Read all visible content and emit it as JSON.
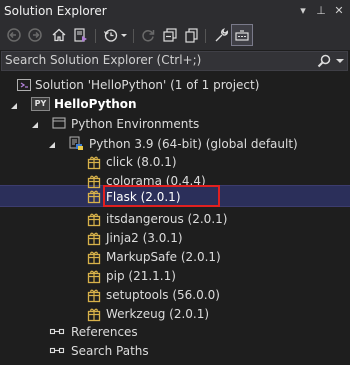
{
  "window": {
    "title": "Solution Explorer",
    "controls": {
      "dropdown": "▾",
      "pin": "⊥",
      "close": "✕"
    }
  },
  "toolbar": {
    "buttons": [
      "back-icon",
      "forward-icon",
      "home-icon",
      "sync-with-active-document-icon",
      "history-icon",
      "refresh-icon",
      "collapse-all-icon",
      "show-all-files-icon",
      "properties-icon",
      "preview-selected-items-icon"
    ]
  },
  "search": {
    "placeholder": "Search Solution Explorer (Ctrl+;)"
  },
  "tree": {
    "solution": "Solution 'HelloPython' (1 of 1 project)",
    "project": "HelloPython",
    "project_badge": "PY",
    "environments": "Python Environments",
    "interpreter": "Python 3.9 (64-bit) (global default)",
    "packages": [
      "click (8.0.1)",
      "colorama (0.4.4)",
      "Flask (2.0.1)",
      "itsdangerous (2.0.1)",
      "Jinja2 (3.0.1)",
      "MarkupSafe (2.0.1)",
      "pip (21.1.1)",
      "setuptools (56.0.0)",
      "Werkzeug (2.0.1)"
    ],
    "selected_package": "Flask (2.0.1)",
    "references": "References",
    "search_paths": "Search Paths"
  },
  "colors": {
    "background": "#1e1e1e",
    "selection": "#2b2f5a",
    "highlight_border": "#e02020",
    "package_icon": "#d8b24a"
  }
}
